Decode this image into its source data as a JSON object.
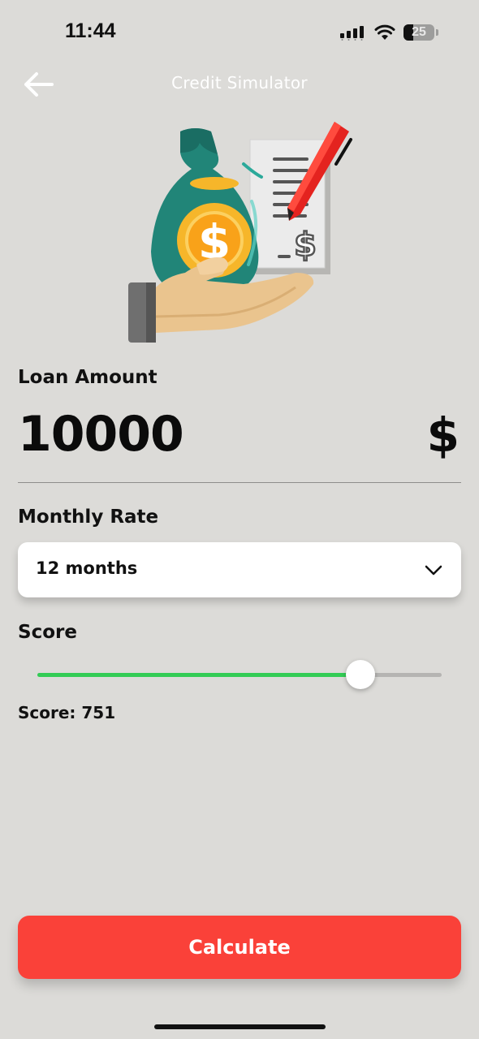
{
  "status_bar": {
    "time": "11:44",
    "battery_level": "25",
    "icons": [
      "cellular-signal-icon",
      "wifi-icon",
      "battery-icon"
    ]
  },
  "header": {
    "title": "Credit Simulator",
    "back_icon": "back-arrow-icon"
  },
  "illustration": {
    "icon": "money-bag-on-hand-with-signed-document",
    "currency_glyph": "$"
  },
  "loan": {
    "label": "Loan Amount",
    "value": "10000",
    "currency": "$"
  },
  "monthly_rate": {
    "label": "Monthly Rate",
    "selected": "12 months",
    "dropdown_icon": "chevron-down-icon"
  },
  "score": {
    "label": "Score",
    "slider_fraction": 0.8,
    "display": "Score: 751"
  },
  "actions": {
    "calculate_label": "Calculate"
  },
  "colors": {
    "background": "#dcdbd8",
    "accent_red": "#fa4139",
    "slider_green": "#33cc55",
    "bag_teal": "#218578",
    "coin_gold": "#f6b62a",
    "pen_red": "#e4231f"
  }
}
